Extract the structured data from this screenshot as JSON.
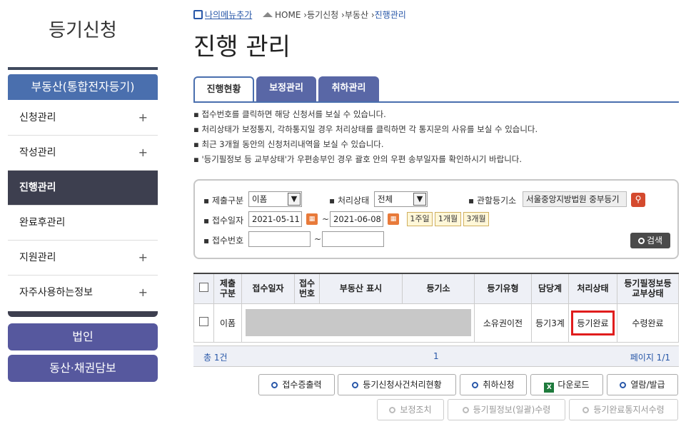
{
  "sidebar": {
    "title": "등기신청",
    "main_label": "부동산(통합전자등기)",
    "items": [
      {
        "label": "신청관리",
        "plus": "+"
      },
      {
        "label": "작성관리",
        "plus": "+"
      },
      {
        "label": "진행관리",
        "plus": ""
      },
      {
        "label": "완료후관리",
        "plus": ""
      },
      {
        "label": "지원관리",
        "plus": "+"
      },
      {
        "label": "자주사용하는정보",
        "plus": "+"
      }
    ],
    "btn_corp": "법인",
    "btn_movable": "동산·채권담보"
  },
  "header": {
    "my_menu": "나의메뉴추가",
    "crumbs": [
      "HOME",
      "등기신청",
      "부동산",
      "진행관리"
    ],
    "crumb_sep": "›",
    "title": "진행 관리"
  },
  "tabs": [
    "진행현황",
    "보정관리",
    "취하관리"
  ],
  "notices": [
    "접수번호를 클릭하면 해당 신청서를 보실 수 있습니다.",
    "처리상태가 보정통지, 각하통지일 경우 처리상태를 클릭하면 각 통지문의 사유를 보실 수 있습니다.",
    "최근 3개월 동안의 신청처리내역을 보실 수 있습니다.",
    "'등기필정보 등 교부상태'가 우편송부인 경우 괄호 안의 우편 송부일자를 확인하시기 바랍니다."
  ],
  "search": {
    "submit_type_label": "제출구분",
    "submit_type_value": "이폼",
    "status_label": "처리상태",
    "status_value": "전체",
    "office_label": "관할등기소",
    "office_value": "서울중앙지방법원 중부등기",
    "date_label": "접수일자",
    "date_from": "2021-05-11",
    "date_to": "2021-06-08",
    "tilde": "~",
    "periods": [
      "1주일",
      "1개월",
      "3개월"
    ],
    "receipt_label": "접수번호",
    "search_btn": "검색"
  },
  "table": {
    "headers": [
      "제출\n구분",
      "접수일자",
      "접수\n번호",
      "부동산 표시",
      "등기소",
      "등기유형",
      "담당계",
      "처리상태",
      "등기필정보등\n교부상태"
    ],
    "row": {
      "submit": "이폼",
      "type": "소유권이전",
      "team": "등기3계",
      "status": "등기완료",
      "delivery": "수령완료"
    },
    "total": "총 1건",
    "page_num": "1",
    "page_info": "페이지 1/1"
  },
  "actions": [
    "접수증출력",
    "등기신청사건처리현황",
    "취하신청",
    "다운로드",
    "열람/발급"
  ],
  "disabled_actions": [
    "보정조치",
    "등기필정보(일괄)수령",
    "등기완료통지서수령"
  ],
  "colors": {
    "accent": "#4a6fae",
    "dark": "#3d3f4f",
    "highlight": "#e01d1d"
  }
}
